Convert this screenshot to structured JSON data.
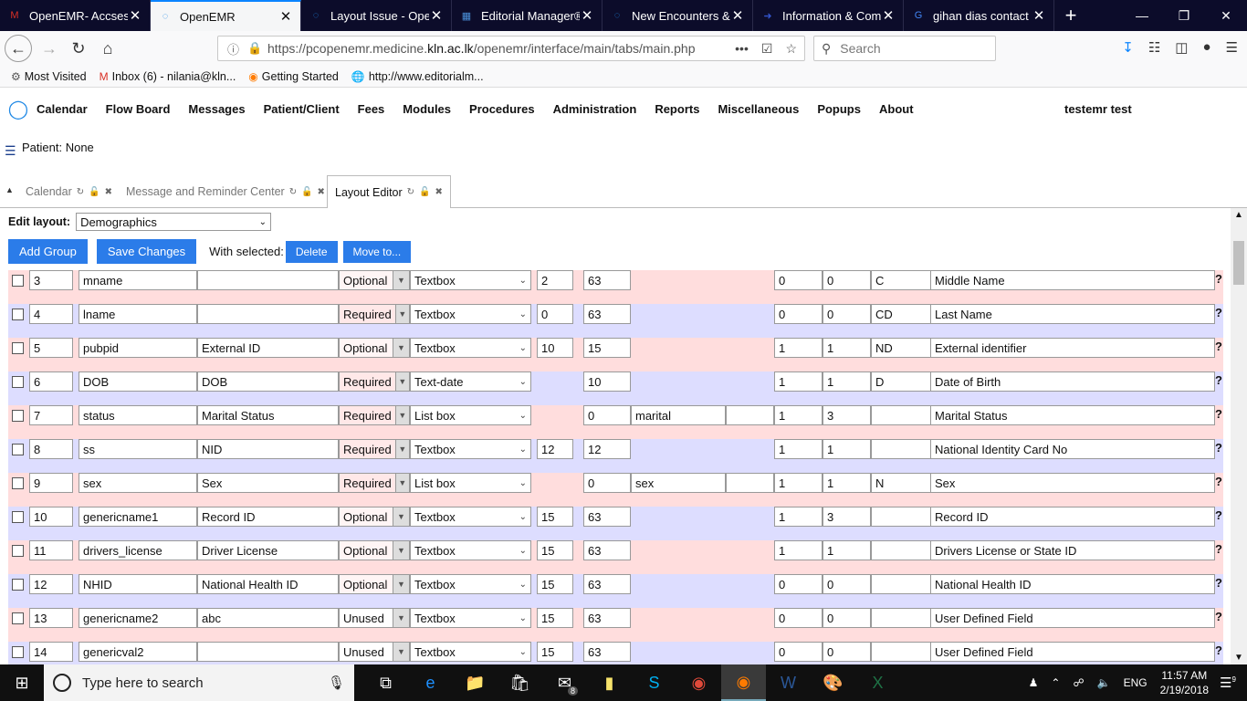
{
  "browser": {
    "tabs": [
      {
        "title": "OpenEMR- Accsess",
        "icon": "gmail-icon",
        "active": false
      },
      {
        "title": "OpenEMR",
        "icon": "openemr-icon",
        "active": true
      },
      {
        "title": "Layout Issue - Open",
        "icon": "openemr-icon",
        "active": false
      },
      {
        "title": "Editorial Manager®",
        "icon": "editorial-icon",
        "active": false
      },
      {
        "title": "New Encounters & ",
        "icon": "openemr-icon",
        "active": false
      },
      {
        "title": "Information & Com",
        "icon": "arrow-icon",
        "active": false
      },
      {
        "title": "gihan dias contact -",
        "icon": "google-icon",
        "active": false
      }
    ],
    "url_prefix": "https://pcopenemr.medicine.",
    "url_domain": "kln.ac.lk",
    "url_suffix": "/openemr/interface/main/tabs/main.php",
    "search_placeholder": "Search",
    "bookmarks": [
      {
        "label": "Most Visited",
        "icon": "gear-icon"
      },
      {
        "label": "Inbox (6) - nilania@kln...",
        "icon": "gmail-icon"
      },
      {
        "label": "Getting Started",
        "icon": "firefox-icon"
      },
      {
        "label": "http://www.editorialm...",
        "icon": "globe-icon"
      }
    ]
  },
  "emr": {
    "menu": [
      "Calendar",
      "Flow Board",
      "Messages",
      "Patient/Client",
      "Fees",
      "Modules",
      "Procedures",
      "Administration",
      "Reports",
      "Miscellaneous",
      "Popups",
      "About"
    ],
    "user": "testemr test",
    "patient": "Patient: None",
    "tabs": [
      {
        "label": "Calendar",
        "active": false
      },
      {
        "label": "Message and Reminder Center",
        "active": false
      },
      {
        "label": "Layout Editor",
        "active": true
      }
    ]
  },
  "editor": {
    "edit_layout_label": "Edit layout:",
    "layout_value": "Demographics",
    "add_group": "Add Group",
    "save_changes": "Save Changes",
    "with_selected": "With selected:",
    "delete": "Delete",
    "move_to": "Move to...",
    "rows": [
      {
        "order": "3",
        "id": "mname",
        "label": "",
        "uor": "Optional",
        "type": "Textbox",
        "w": "2",
        "h": "63",
        "list": null,
        "cols": "0",
        "span": "0",
        "opts": "C",
        "desc": "Middle Name",
        "bg": "pink"
      },
      {
        "order": "4",
        "id": "lname",
        "label": "",
        "uor": "Required",
        "type": "Textbox",
        "w": "0",
        "h": "63",
        "list": null,
        "cols": "0",
        "span": "0",
        "opts": "CD",
        "desc": "Last Name",
        "bg": "blue"
      },
      {
        "order": "5",
        "id": "pubpid",
        "label": "External ID",
        "uor": "Optional",
        "type": "Textbox",
        "w": "10",
        "h": "15",
        "list": null,
        "cols": "1",
        "span": "1",
        "opts": "ND",
        "desc": "External identifier",
        "bg": "pink"
      },
      {
        "order": "6",
        "id": "DOB",
        "label": "DOB",
        "uor": "Required",
        "type": "Text-date",
        "w": null,
        "h": "10",
        "list": null,
        "cols": "1",
        "span": "1",
        "opts": "D",
        "desc": "Date of Birth",
        "bg": "blue"
      },
      {
        "order": "7",
        "id": "status",
        "label": "Marital Status",
        "uor": "Required",
        "type": "List box",
        "w": null,
        "h": "0",
        "list": "marital",
        "cols": "1",
        "span": "3",
        "opts": "",
        "desc": "Marital Status",
        "bg": "pink"
      },
      {
        "order": "8",
        "id": "ss",
        "label": "NID",
        "uor": "Required",
        "type": "Textbox",
        "w": "12",
        "h": "12",
        "list": null,
        "cols": "1",
        "span": "1",
        "opts": "",
        "desc": "National Identity Card No",
        "bg": "blue"
      },
      {
        "order": "9",
        "id": "sex",
        "label": "Sex",
        "uor": "Required",
        "type": "List box",
        "w": null,
        "h": "0",
        "list": "sex",
        "cols": "1",
        "span": "1",
        "opts": "N",
        "desc": "Sex",
        "bg": "pink"
      },
      {
        "order": "10",
        "id": "genericname1",
        "label": "Record ID",
        "uor": "Optional",
        "type": "Textbox",
        "w": "15",
        "h": "63",
        "list": null,
        "cols": "1",
        "span": "3",
        "opts": "",
        "desc": "Record ID",
        "bg": "blue"
      },
      {
        "order": "11",
        "id": "drivers_license",
        "label": "Driver License",
        "uor": "Optional",
        "type": "Textbox",
        "w": "15",
        "h": "63",
        "list": null,
        "cols": "1",
        "span": "1",
        "opts": "",
        "desc": "Drivers License or State ID",
        "bg": "pink"
      },
      {
        "order": "12",
        "id": "NHID",
        "label": "National Health ID",
        "uor": "Optional",
        "type": "Textbox",
        "w": "15",
        "h": "63",
        "list": null,
        "cols": "0",
        "span": "0",
        "opts": "",
        "desc": "National Health ID",
        "bg": "blue"
      },
      {
        "order": "13",
        "id": "genericname2",
        "label": "abc",
        "uor": "Unused",
        "type": "Textbox",
        "w": "15",
        "h": "63",
        "list": null,
        "cols": "0",
        "span": "0",
        "opts": "",
        "desc": "User Defined Field",
        "bg": "pink"
      },
      {
        "order": "14",
        "id": "genericval2",
        "label": "",
        "uor": "Unused",
        "type": "Textbox",
        "w": "15",
        "h": "63",
        "list": null,
        "cols": "0",
        "span": "0",
        "opts": "",
        "desc": "User Defined Field",
        "bg": "blue"
      }
    ]
  },
  "taskbar": {
    "search_placeholder": "Type here to search",
    "lang": "ENG",
    "time": "11:57 AM",
    "date": "2/19/2018",
    "mail_badge": "8",
    "notif_badge": "9"
  },
  "colors": {
    "accent": "#2b7ce9",
    "pink_row": "#ffdddd",
    "blue_row": "#ddddff",
    "tabstrip": "#0c0c2a"
  }
}
